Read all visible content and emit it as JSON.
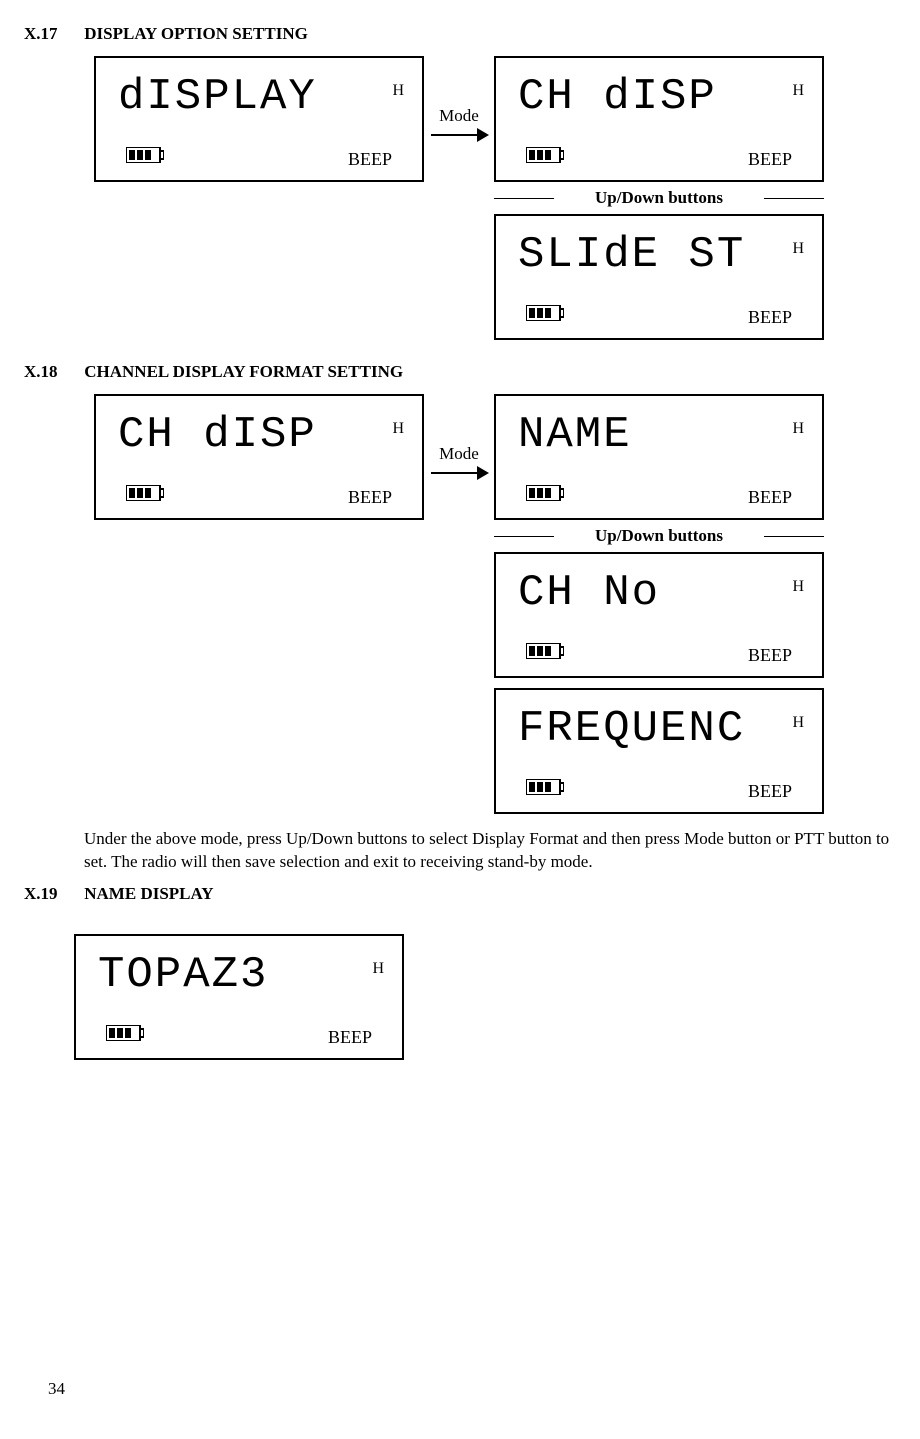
{
  "page_number": "34",
  "sections": {
    "x17": {
      "num": "X.17",
      "title": "DISPLAY OPTION SETTING",
      "mode_label": "Mode",
      "updown_label": "Up/Down buttons",
      "left_lcd": {
        "text": "dISPLAY",
        "h": "H",
        "beep": "BEEP"
      },
      "right_lcds": [
        {
          "text": "CH dISP",
          "h": "H",
          "beep": "BEEP"
        },
        {
          "text": "SLIdE ST",
          "h": "H",
          "beep": "BEEP"
        }
      ]
    },
    "x18": {
      "num": "X.18",
      "title": "CHANNEL DISPLAY FORMAT SETTING",
      "mode_label": "Mode",
      "updown_label": "Up/Down buttons",
      "left_lcd": {
        "text": "CH dISP",
        "h": "H",
        "beep": "BEEP"
      },
      "right_lcds": [
        {
          "text": "NAME",
          "h": "H",
          "beep": "BEEP"
        },
        {
          "text": "CH No",
          "h": "H",
          "beep": "BEEP"
        },
        {
          "text": "FREQUENC",
          "h": "H",
          "beep": "BEEP"
        }
      ],
      "body": "Under the above mode, press Up/Down buttons to select Display Format and then press Mode button or PTT button to set. The radio will then save selection and exit to receiving stand-by mode."
    },
    "x19": {
      "num": "X.19",
      "title": "NAME DISPLAY",
      "lcd": {
        "text": "TOPAZ3",
        "h": "H",
        "beep": "BEEP"
      }
    }
  }
}
